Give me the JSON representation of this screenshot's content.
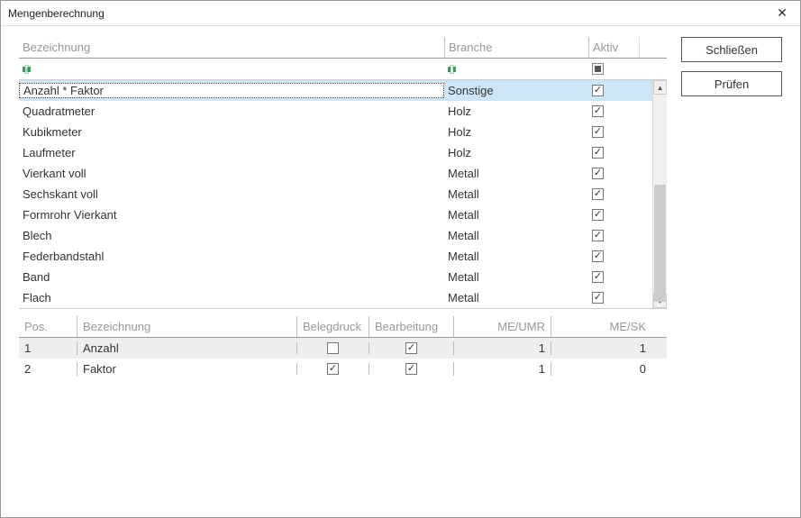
{
  "window": {
    "title": "Mengenberechnung"
  },
  "buttons": {
    "close": "Schließen",
    "check": "Prüfen"
  },
  "top_grid": {
    "headers": {
      "bezeichnung": "Bezeichnung",
      "branche": "Branche",
      "aktiv": "Aktiv"
    },
    "rows": [
      {
        "bezeichnung": "Anzahl * Faktor",
        "branche": "Sonstige",
        "aktiv": true,
        "selected": true
      },
      {
        "bezeichnung": "Quadratmeter",
        "branche": "Holz",
        "aktiv": true
      },
      {
        "bezeichnung": "Kubikmeter",
        "branche": "Holz",
        "aktiv": true
      },
      {
        "bezeichnung": "Laufmeter",
        "branche": "Holz",
        "aktiv": true
      },
      {
        "bezeichnung": "Vierkant voll",
        "branche": "Metall",
        "aktiv": true
      },
      {
        "bezeichnung": "Sechskant voll",
        "branche": "Metall",
        "aktiv": true
      },
      {
        "bezeichnung": "Formrohr Vierkant",
        "branche": "Metall",
        "aktiv": true
      },
      {
        "bezeichnung": "Blech",
        "branche": "Metall",
        "aktiv": true
      },
      {
        "bezeichnung": "Federbandstahl",
        "branche": "Metall",
        "aktiv": true
      },
      {
        "bezeichnung": "Band",
        "branche": "Metall",
        "aktiv": true
      },
      {
        "bezeichnung": "Flach",
        "branche": "Metall",
        "aktiv": true
      }
    ]
  },
  "bottom_grid": {
    "headers": {
      "pos": "Pos.",
      "bezeichnung": "Bezeichnung",
      "belegdruck": "Belegdruck",
      "bearbeitung": "Bearbeitung",
      "me_umr": "ME/UMR",
      "me_sk": "ME/SK"
    },
    "rows": [
      {
        "pos": "1",
        "bezeichnung": "Anzahl",
        "belegdruck": false,
        "bearbeitung": true,
        "me_umr": "1",
        "me_sk": "1",
        "shade": true
      },
      {
        "pos": "2",
        "bezeichnung": "Faktor",
        "belegdruck": true,
        "bearbeitung": true,
        "me_umr": "1",
        "me_sk": "0"
      }
    ]
  }
}
